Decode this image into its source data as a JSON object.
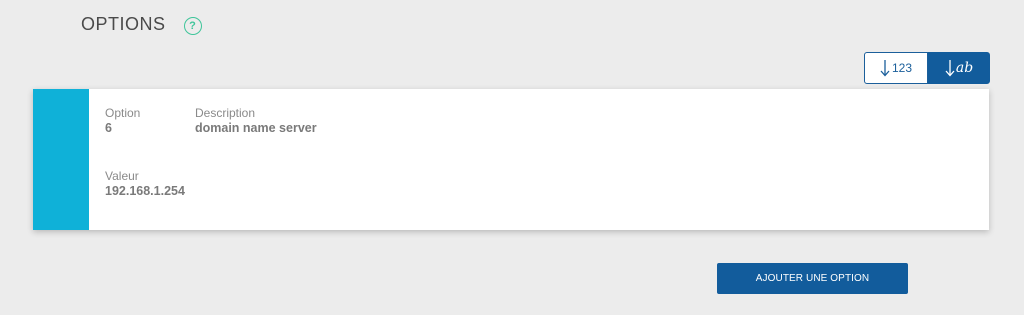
{
  "header": {
    "title": "OPTIONS",
    "help_symbol": "?"
  },
  "sort": {
    "numeric_label": "123",
    "alpha_label": "ab",
    "active": "alpha"
  },
  "option_card": {
    "option_label": "Option",
    "option_value": "6",
    "description_label": "Description",
    "description_value": "domain name server",
    "value_label": "Valeur",
    "value_value": "192.168.1.254"
  },
  "actions": {
    "add_option_label": "AJOUTER UNE OPTION"
  },
  "colors": {
    "background": "#ececec",
    "accent": "#0fb1d8",
    "primary": "#125c9c",
    "help": "#3fc59a"
  }
}
